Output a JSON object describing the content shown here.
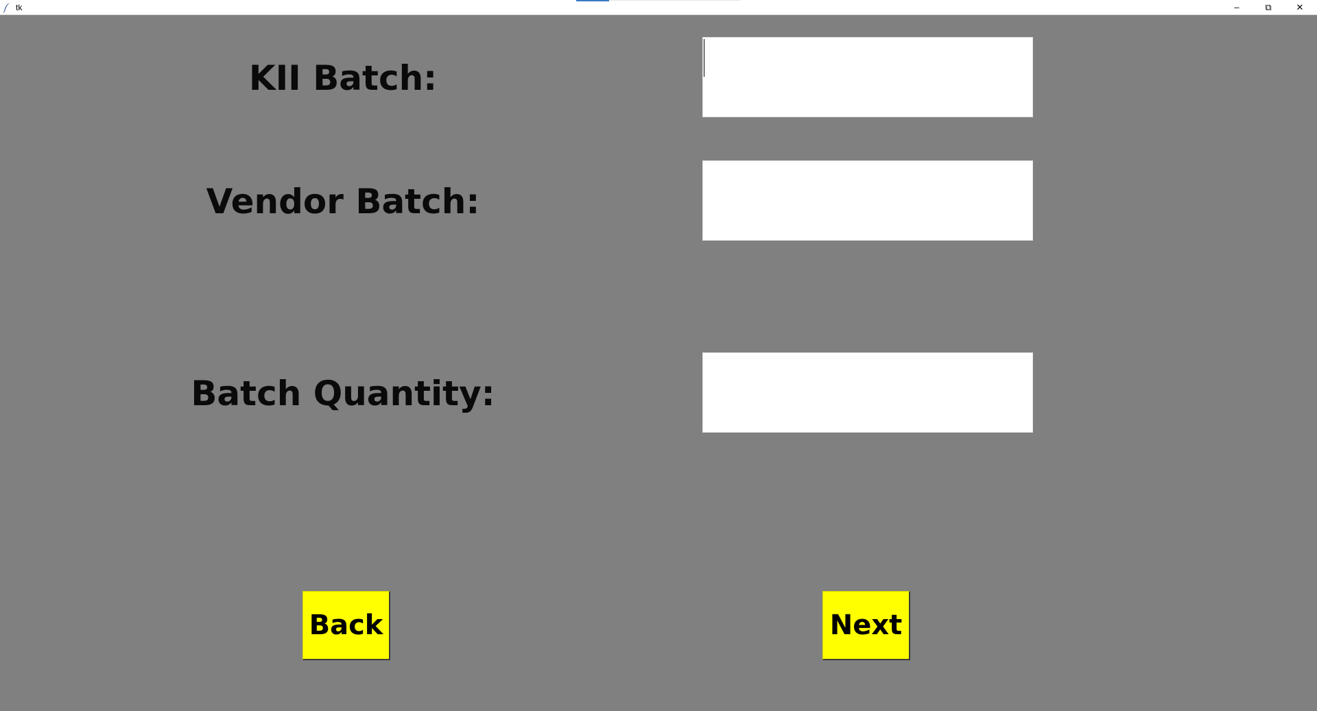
{
  "window": {
    "title": "tk",
    "controls": {
      "minimize": "–",
      "restore": "⧉",
      "close": "✕"
    },
    "background": "#808080"
  },
  "form": {
    "kii_batch": {
      "label": "KII Batch:",
      "value": "",
      "focused": true
    },
    "vendor_batch": {
      "label": "Vendor Batch:",
      "value": ""
    },
    "batch_quantity": {
      "label": "Batch Quantity:",
      "value": ""
    }
  },
  "buttons": {
    "back_label": "Back",
    "next_label": "Next",
    "color": "#ffff00"
  },
  "icons": {
    "app": "feather-icon"
  }
}
